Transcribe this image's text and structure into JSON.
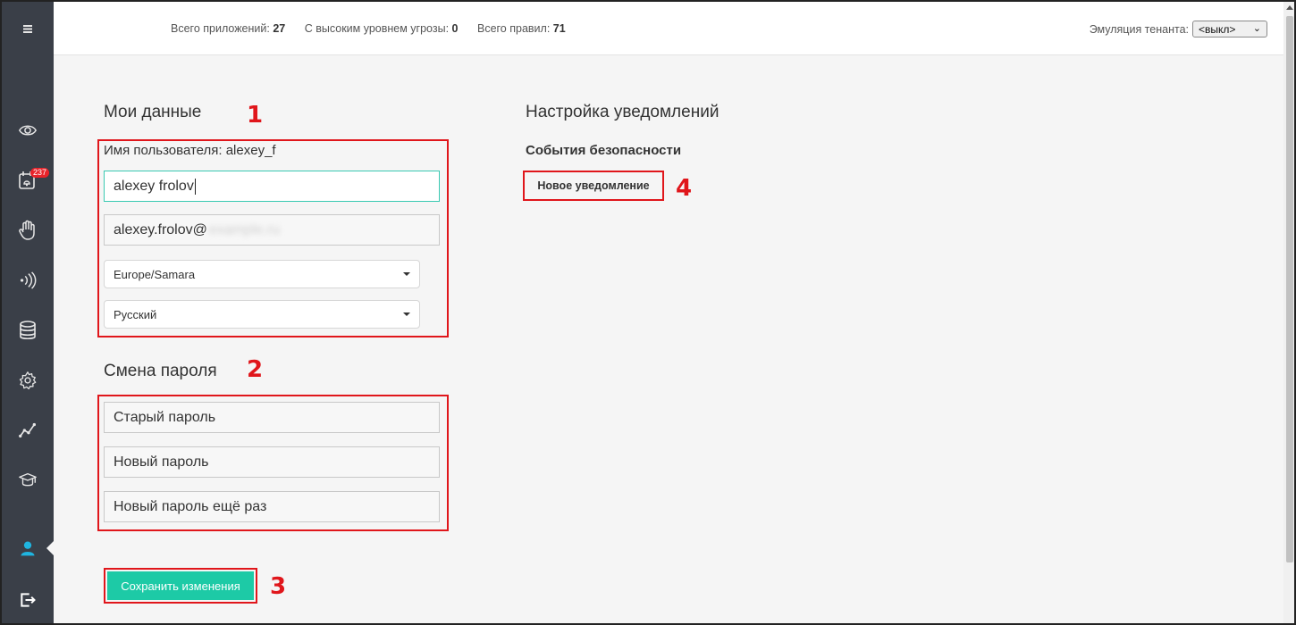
{
  "header": {
    "stats": [
      {
        "label": "Всего приложений:",
        "value": "27"
      },
      {
        "label": "С высоким уровнем угрозы:",
        "value": "0"
      },
      {
        "label": "Всего правил:",
        "value": "71"
      }
    ],
    "tenant_label": "Эмуляция тенанта:",
    "tenant_value": "<выкл>"
  },
  "sidebar": {
    "items": [
      {
        "icon": "menu-icon"
      },
      {
        "icon": "eye-icon"
      },
      {
        "icon": "alerts-icon",
        "badge": "237"
      },
      {
        "icon": "hand-icon"
      },
      {
        "icon": "signal-icon"
      },
      {
        "icon": "database-icon"
      },
      {
        "icon": "gear-icon"
      },
      {
        "icon": "chart-line-icon"
      },
      {
        "icon": "graduation-cap-icon"
      },
      {
        "icon": "user-icon",
        "active": true
      },
      {
        "icon": "logout-icon"
      }
    ],
    "accent_color": "#1fb5e0"
  },
  "profile": {
    "title": "Мои данные",
    "username_label": "Имя пользователя: alexey_f",
    "full_name": "alexey frolov",
    "email": "alexey.frolov@",
    "email_hidden": "example.ru",
    "timezone": "Europe/Samara",
    "language": "Русский"
  },
  "password": {
    "title": "Смена пароля",
    "old_placeholder": "Старый пароль",
    "new_placeholder": "Новый пароль",
    "repeat_placeholder": "Новый пароль ещё раз"
  },
  "save_button": "Сохранить изменения",
  "notifications": {
    "title": "Настройка уведомлений",
    "subtitle": "События безопасности",
    "new_button": "Новое уведомление"
  },
  "annotations": [
    "1",
    "2",
    "3",
    "4"
  ],
  "colors": {
    "annotation_red": "#e0161b",
    "button_teal": "#1dcaa6",
    "sidebar_bg": "#3a3f48"
  }
}
